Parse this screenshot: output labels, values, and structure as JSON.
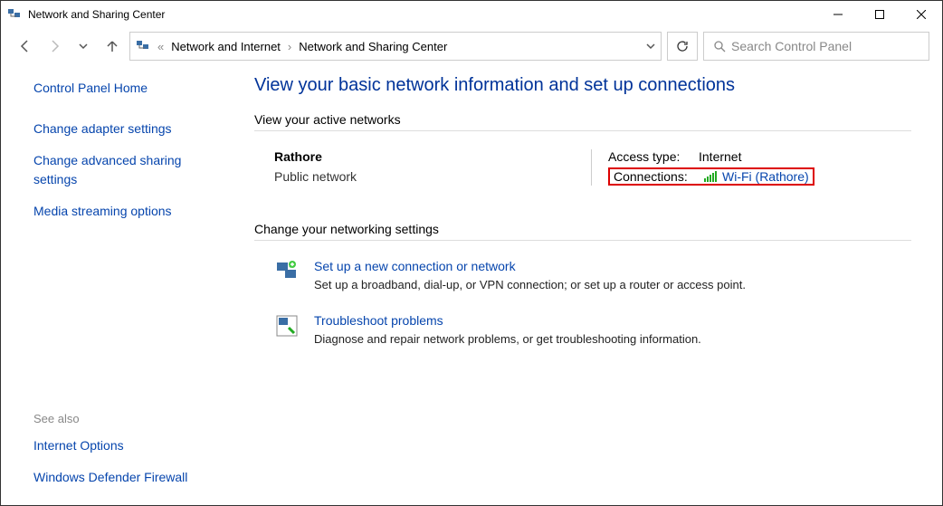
{
  "window": {
    "title": "Network and Sharing Center"
  },
  "breadcrumb": {
    "level1": "Network and Internet",
    "level2": "Network and Sharing Center"
  },
  "search": {
    "placeholder": "Search Control Panel"
  },
  "sidebar": {
    "home": "Control Panel Home",
    "adapter": "Change adapter settings",
    "advanced": "Change advanced sharing settings",
    "media": "Media streaming options",
    "seealso_label": "See also",
    "internet_options": "Internet Options",
    "firewall": "Windows Defender Firewall"
  },
  "main": {
    "heading": "View your basic network information and set up connections",
    "active_label": "View your active networks",
    "network": {
      "name": "Rathore",
      "type": "Public network",
      "access_label": "Access type:",
      "access_value": "Internet",
      "conn_label": "Connections:",
      "conn_value": "Wi-Fi (Rathore)"
    },
    "change_label": "Change your networking settings",
    "setup": {
      "title": "Set up a new connection or network",
      "desc": "Set up a broadband, dial-up, or VPN connection; or set up a router or access point."
    },
    "trouble": {
      "title": "Troubleshoot problems",
      "desc": "Diagnose and repair network problems, or get troubleshooting information."
    }
  }
}
